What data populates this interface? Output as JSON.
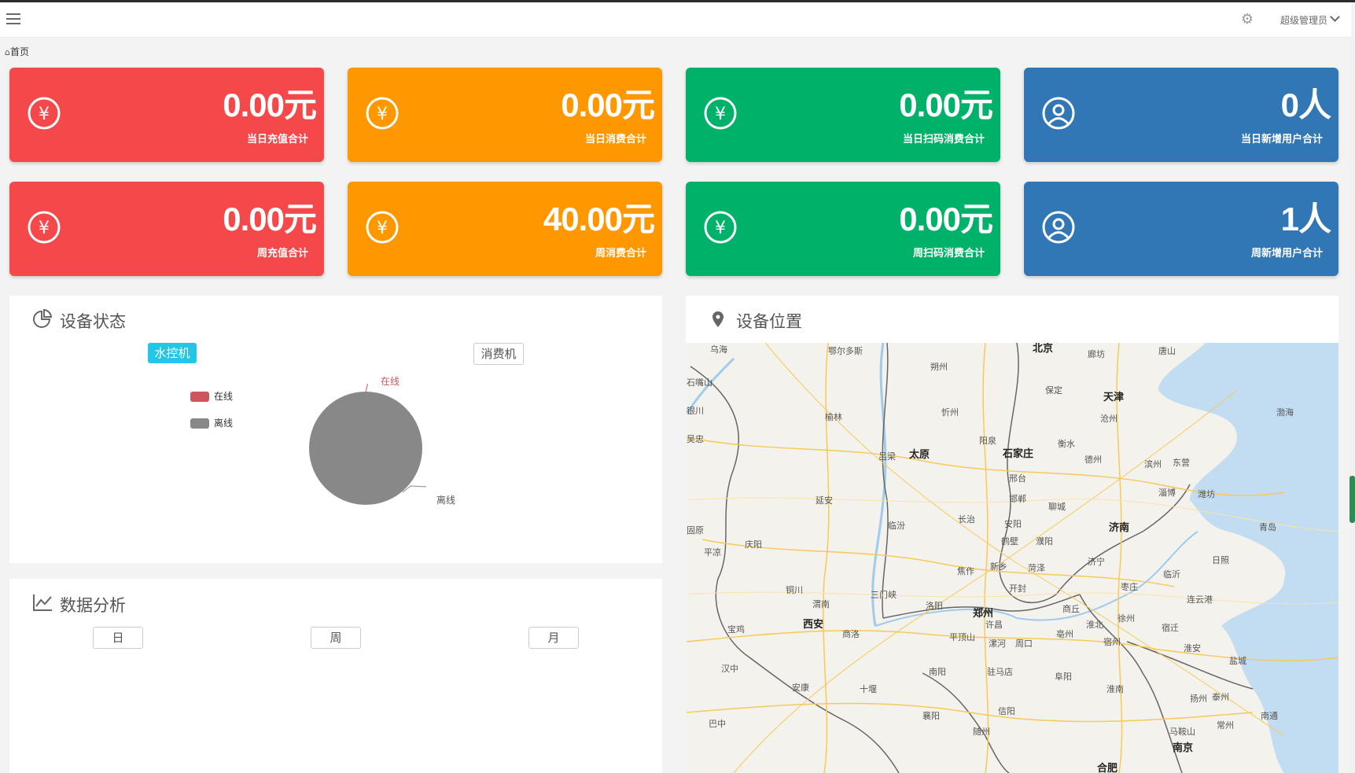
{
  "header": {
    "user_label": "超级管理员"
  },
  "breadcrumb": {
    "home": "首页"
  },
  "cards": [
    {
      "value": "0.00元",
      "label": "当日充值合计",
      "icon": "yen-icon"
    },
    {
      "value": "0.00元",
      "label": "当日消费合计",
      "icon": "yen-icon"
    },
    {
      "value": "0.00元",
      "label": "当日扫码消费合计",
      "icon": "yen-icon"
    },
    {
      "value": "0人",
      "label": "当日新增用户合计",
      "icon": "user-icon"
    },
    {
      "value": "0.00元",
      "label": "周充值合计",
      "icon": "yen-icon"
    },
    {
      "value": "40.00元",
      "label": "周消费合计",
      "icon": "yen-icon"
    },
    {
      "value": "0.00元",
      "label": "周扫码消费合计",
      "icon": "yen-icon"
    },
    {
      "value": "1人",
      "label": "周新增用户合计",
      "icon": "user-icon"
    }
  ],
  "colors": {
    "red": "#f5484a",
    "orange": "#ff9800",
    "green": "#00b169",
    "blue": "#3277b5",
    "online": "#c9575b",
    "offline": "#888888"
  },
  "device_status": {
    "title": "设备状态",
    "tabs": {
      "water": "水控机",
      "consume": "消费机"
    },
    "legend": {
      "online": "在线",
      "offline": "离线"
    },
    "pie_labels": {
      "online": "在线",
      "offline": "离线"
    }
  },
  "analysis": {
    "title": "数据分析",
    "buttons": {
      "day": "日",
      "week": "周",
      "month": "月"
    }
  },
  "location": {
    "title": "设备位置",
    "cities": {
      "beijing": "北京",
      "tianjin": "天津",
      "shijiazhuang": "石家庄",
      "taiyuan": "太原",
      "jinan": "济南",
      "zhengzhou": "郑州",
      "xian": "西安",
      "nanjing": "南京",
      "hefei": "合肥",
      "bohai": "渤海",
      "yinchuan": "银川",
      "baoding": "保定",
      "xinzhou": "忻州",
      "yangquan": "阳泉",
      "hengshui": "衡水",
      "cangzhou": "沧州",
      "yulin": "榆林",
      "lvliang": "吕梁",
      "xingtai": "邢台",
      "handan": "邯郸",
      "yanan": "延安",
      "linfen": "临汾",
      "changzhi": "长治",
      "anyang": "安阳",
      "liaocheng": "聊城",
      "dezhou": "德州",
      "binzhou": "滨州",
      "dongying": "东营",
      "zibo": "淄博",
      "weifang": "潍坊",
      "qingdao": "青岛",
      "rizhao": "日照",
      "linyi": "临沂",
      "jining": "济宁",
      "zaozhuang": "枣庄",
      "xuzhou": "徐州",
      "lianyungang": "连云港",
      "suqian": "宿迁",
      "huaian": "淮安",
      "yancheng": "盐城",
      "yangzhou": "扬州",
      "taizhou": "泰州",
      "xinxiang": "新乡",
      "hebi": "鹤壁",
      "puyang": "濮阳",
      "heze": "菏泽",
      "kaifeng": "开封",
      "luoyang": "洛阳",
      "sanmenxia": "三门峡",
      "jiaozuo": "焦作",
      "xuchang": "许昌",
      "pingdingshan": "平顶山",
      "luohe": "漯河",
      "zhoukou": "周口",
      "shangqiu": "商丘",
      "bozhou": "亳州",
      "huaibei": "淮北",
      "suzhou": "宿州",
      "fuyang": "阜阳",
      "huainan": "淮南",
      "nanyang": "南阳",
      "zhumadian": "驻马店",
      "xinyang": "信阳",
      "xiangyang": "襄阳",
      "suizhou": "随州",
      "shiyan": "十堰",
      "ankang": "安康",
      "hanzhong": "汉中",
      "baoji": "宝鸡",
      "tongchuan": "铜川",
      "weinan": "渭南",
      "shangluo": "商洛",
      "qingyang": "庆阳",
      "pingliang": "平凉",
      "guyuan": "固原",
      "wuzhong": "吴忠",
      "ordos": "鄂尔多斯",
      "wuhai": "乌海",
      "shuozhou": "朔州",
      "langfang": "廊坊",
      "tangshan": "唐山",
      "changzhou": "常州",
      "nantong": "南通",
      "maanshan": "马鞍山",
      "bazhong": "巴中",
      "shizuishan": "石嘴山"
    }
  }
}
